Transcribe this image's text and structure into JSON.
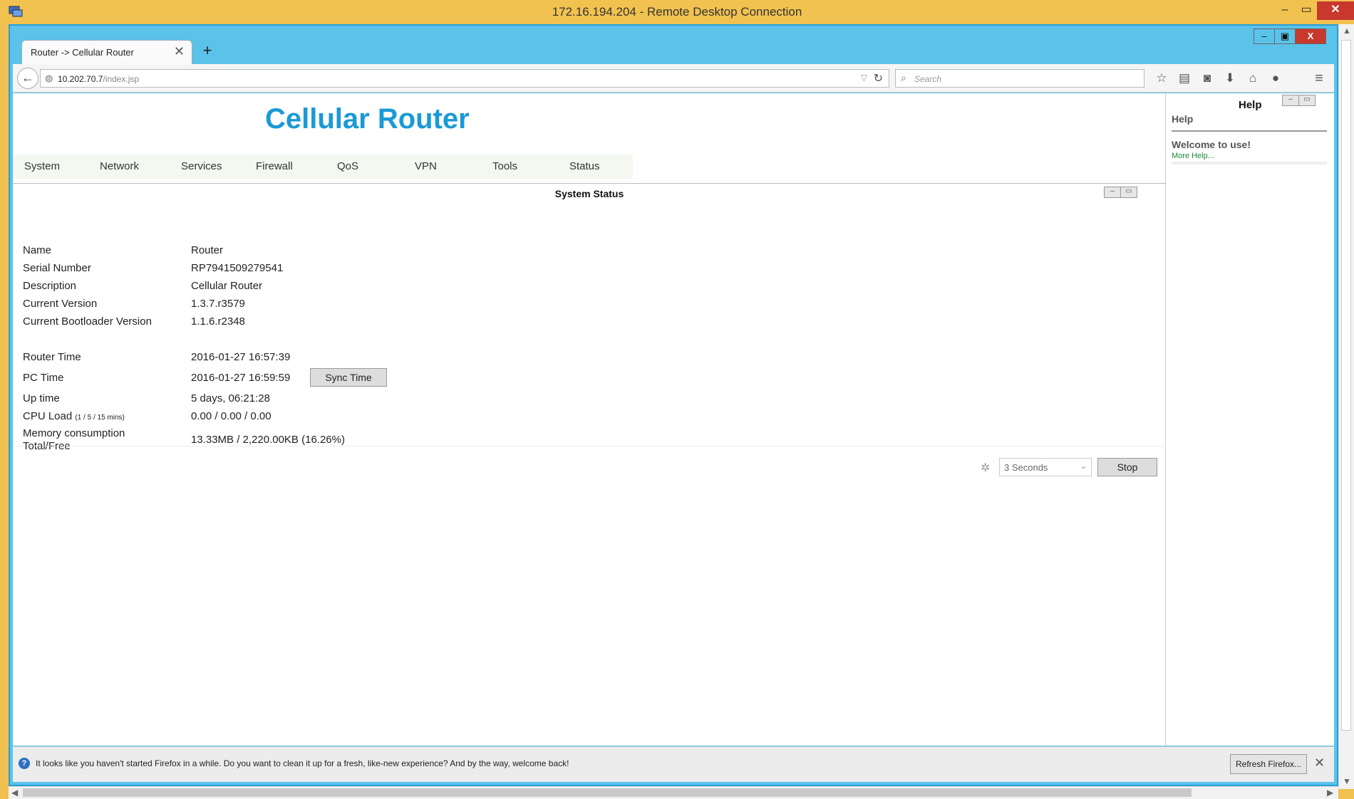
{
  "rdp": {
    "title": "172.16.194.204 - Remote Desktop Connection",
    "controls": {
      "minimize": "–",
      "maximize": "▭",
      "close": "✕"
    }
  },
  "browser": {
    "window_controls": {
      "minimize": "–",
      "restore": "▣",
      "close": "X"
    },
    "tab": {
      "title": "Router -> Cellular Router",
      "close": "✕"
    },
    "new_tab": "+",
    "url": {
      "host": "10.202.70.7",
      "path": "/index.jsp"
    },
    "search_placeholder": "Search",
    "toolbar_icons": [
      "star-icon",
      "reading-list-icon",
      "pocket-icon",
      "downloads-icon",
      "home-icon",
      "chat-icon"
    ],
    "menu_icon": "≡"
  },
  "page": {
    "brand": "Cellular Router",
    "menu": [
      "System",
      "Network",
      "Services",
      "Firewall",
      "QoS",
      "VPN",
      "Tools",
      "Status"
    ],
    "panel_title": "System Status",
    "status": {
      "name_label": "Name",
      "name_value": "Router",
      "serial_label": "Serial Number",
      "serial_value": "RP7941509279541",
      "desc_label": "Description",
      "desc_value": "Cellular Router",
      "version_label": "Current Version",
      "version_value": "1.3.7.r3579",
      "bootloader_label": "Current Bootloader Version",
      "bootloader_value": "1.1.6.r2348",
      "router_time_label": "Router Time",
      "router_time_value": "2016-01-27 16:57:39",
      "pc_time_label": "PC Time",
      "pc_time_value": "2016-01-27 16:59:59",
      "sync_button": "Sync Time",
      "uptime_label": "Up time",
      "uptime_value": "5 days, 06:21:28",
      "cpu_label": "CPU Load",
      "cpu_label_small": "(1 / 5 / 15 mins)",
      "cpu_value": "0.00 / 0.00 / 0.00",
      "memory_label_1": "Memory consumption",
      "memory_label_2": "Total/Free",
      "memory_value": "13.33MB / 2,220.00KB (16.26%)"
    },
    "refresh": {
      "interval": "3 Seconds",
      "stop_button": "Stop"
    }
  },
  "help": {
    "heading": "Help",
    "subheading": "Help",
    "welcome": "Welcome to use!",
    "more_link": "More Help..."
  },
  "notification": {
    "message": "It looks like you haven't started Firefox in a while. Do you want to clean it up for a fresh, like-new experience? And by the way, welcome back!",
    "button": "Refresh Firefox...",
    "dismiss": "✕"
  }
}
